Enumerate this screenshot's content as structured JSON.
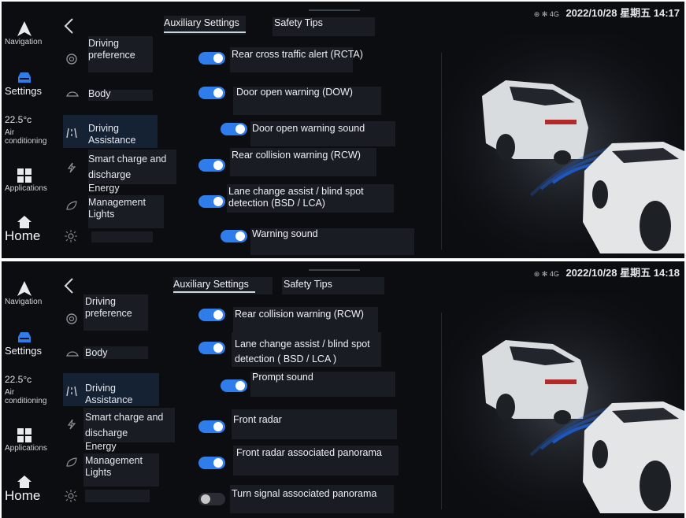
{
  "screens": [
    {
      "status": {
        "icons": "⊛  ✻  4G",
        "datetime": "2022/10/28 星期五 14:17"
      },
      "tabs": {
        "aux": "Auxiliary Settings",
        "safety": "Safety Tips"
      },
      "nav": {
        "navigation": "Navigation",
        "settings": "Settings",
        "temp": "22.5°c",
        "air": "Air conditioning",
        "applications": "Applications",
        "home": "Home"
      },
      "categories": {
        "driving_pref": "Driving preference",
        "body": "Body",
        "driving_assist": "Driving Assistance",
        "smart_charge": "Smart charge and discharge",
        "energy": "Energy",
        "mgmt_lights": "Management Lights"
      },
      "options": [
        {
          "label": "Rear cross traffic alert (RCTA)",
          "state": "on"
        },
        {
          "label": "Door open warning (DOW)",
          "state": "on"
        },
        {
          "label": "Door open warning sound",
          "state": "on"
        },
        {
          "label": "Rear collision warning (RCW)",
          "state": "on"
        },
        {
          "label": "Lane change assist / blind spot detection (BSD / LCA)",
          "state": "on"
        },
        {
          "label": "Warning sound",
          "state": "on"
        }
      ]
    },
    {
      "status": {
        "icons": "⊛  ✻  4G",
        "datetime": "2022/10/28 星期五 14:18"
      },
      "tabs": {
        "aux": "Auxiliary Settings",
        "safety": "Safety Tips"
      },
      "nav": {
        "navigation": "Navigation",
        "settings": "Settings",
        "temp": "22.5°c",
        "air": "Air conditioning",
        "applications": "Applications",
        "home": "Home"
      },
      "categories": {
        "driving_pref": "Driving preference",
        "body": "Body",
        "driving_assist": "Driving Assistance",
        "smart_charge": "Smart charge and discharge",
        "energy": "Energy",
        "mgmt_lights": "Management Lights"
      },
      "options": [
        {
          "label": "Rear collision warning (RCW)",
          "state": "on"
        },
        {
          "label": "Lane change assist / blind spot detection ( BSD / LCA )",
          "state": "on"
        },
        {
          "label": "Prompt sound",
          "state": "on"
        },
        {
          "label": "Front radar",
          "state": "on"
        },
        {
          "label": "Front radar associated panorama",
          "state": "on"
        },
        {
          "label": "Turn signal associated panorama",
          "state": "off"
        }
      ]
    }
  ],
  "colors": {
    "accent": "#2f7dea",
    "background": "#0b0d11",
    "panel": "#191c22",
    "highlight": "#152233"
  }
}
